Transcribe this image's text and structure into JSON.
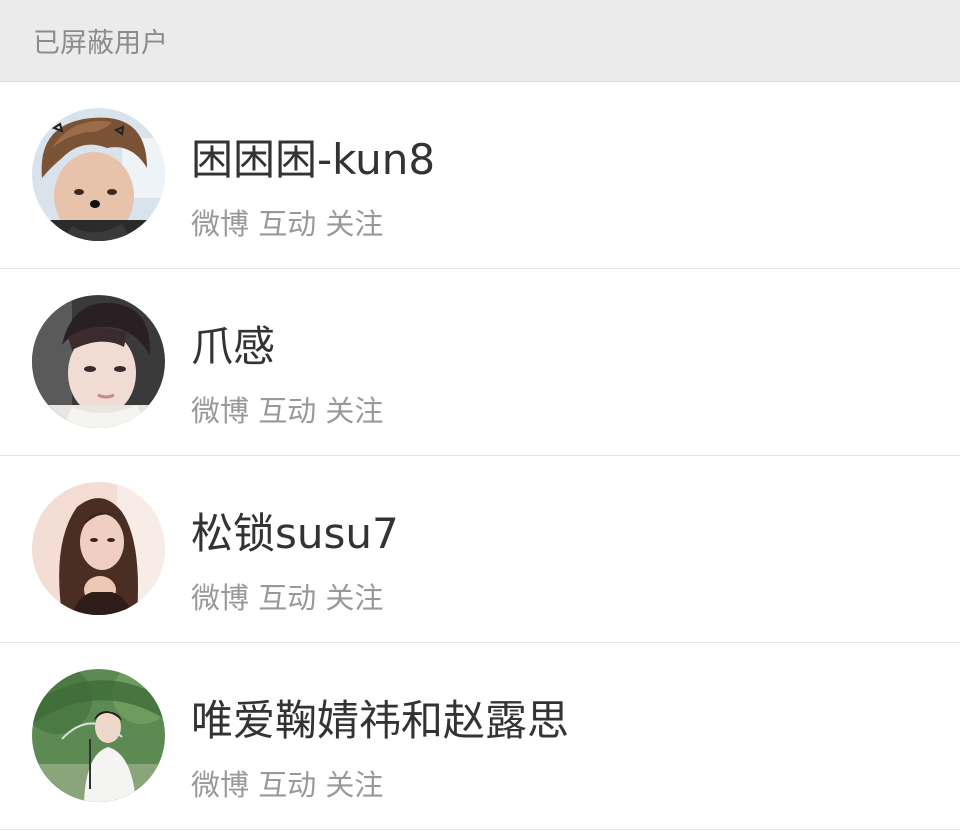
{
  "header": {
    "title": "已屏蔽用户"
  },
  "users": [
    {
      "name": "困困困-kun8",
      "tags": "微博 互动 关注",
      "avatar": "avatar-1"
    },
    {
      "name": "爪感",
      "tags": "微博 互动 关注",
      "avatar": "avatar-2"
    },
    {
      "name": "松锁susu7",
      "tags": "微博 互动 关注",
      "avatar": "avatar-3"
    },
    {
      "name": "唯爱鞠婧祎和赵露思",
      "tags": "微博 互动 关注",
      "avatar": "avatar-4"
    }
  ]
}
